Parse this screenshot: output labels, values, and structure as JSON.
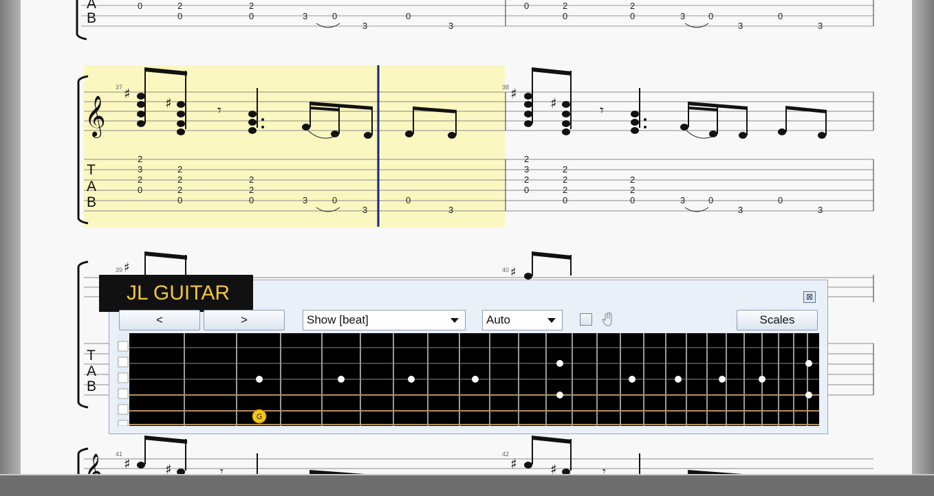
{
  "score": {
    "bar_numbers": [
      "37",
      "38",
      "39",
      "40",
      "41",
      "42"
    ],
    "tab_clef": [
      "T",
      "A",
      "B"
    ],
    "system0_tab": [
      [
        "0",
        "2",
        "0",
        "2",
        "0",
        "3",
        "0",
        "3",
        "0",
        "3"
      ],
      [
        "0",
        "2",
        "0",
        "2",
        "0",
        "3",
        "0",
        "3",
        "0",
        "3"
      ]
    ],
    "system1_tab": {
      "bar37": [
        "2",
        "3",
        "2",
        "0",
        "2",
        "2",
        "2",
        "0",
        "2",
        "2",
        "0",
        "3",
        "0",
        "3"
      ],
      "bar_half": [
        "0",
        "3"
      ],
      "bar38": [
        "2",
        "3",
        "2",
        "0",
        "2",
        "2",
        "2",
        "0",
        "2",
        "2",
        "0",
        "3",
        "0",
        "3",
        "0",
        "3"
      ]
    },
    "selection_color": "#fbf7c0"
  },
  "watermark": {
    "text": "JL GUITAR",
    "color": "#f3c63b"
  },
  "fretboard_window": {
    "close_icon": "close-icon",
    "prev_label": "<",
    "next_label": ">",
    "show_select": "Show [beat]",
    "mode_select": "Auto",
    "scales_label": "Scales",
    "hand_icon": "hand-icon",
    "note_label": "G",
    "note_color": "#f5c518"
  }
}
